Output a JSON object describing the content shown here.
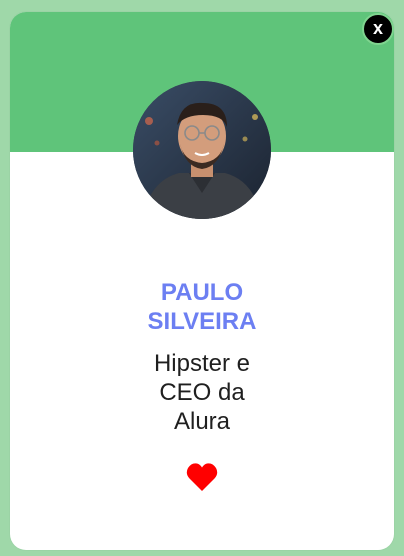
{
  "profile": {
    "name_line1": "PAULO",
    "name_line2": "SILVEIRA",
    "role_line1": "Hipster e",
    "role_line2": "CEO da",
    "role_line3": "Alura"
  },
  "close": {
    "label": "x"
  },
  "icons": {
    "like": "heart-icon",
    "close": "close-icon"
  },
  "colors": {
    "background": "#9fd8a9",
    "header": "#5fc47a",
    "name": "#6c7ff2",
    "heart": "#ff0000",
    "close_bg": "#000000"
  }
}
